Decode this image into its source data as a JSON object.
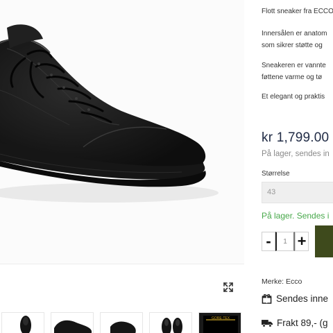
{
  "description": {
    "lines": [
      "Flott sneaker fra ECCO",
      "Innersålen er anatom",
      "som sikrer støtte og",
      "Sneakeren er vannte",
      "føttene varme og tø",
      "Et elegant og praktis"
    ]
  },
  "price": "kr 1,799.00",
  "stock_note": "På lager, sendes in",
  "size": {
    "label": "Størrelse",
    "selected": "43"
  },
  "stock_status": "På lager. Sendes i",
  "quantity": {
    "minus": "-",
    "value": "1",
    "plus": "+"
  },
  "brand": "Merke: Ecco",
  "shipping": {
    "dispatch": "Sendes inne",
    "freight": "Frakt 89,- (g"
  },
  "thumbnails": [
    {
      "alt": "shoe-front-thumbnail"
    },
    {
      "alt": "shoe-side-thumbnail"
    },
    {
      "alt": "shoe-back-thumbnail"
    },
    {
      "alt": "shoe-pair-thumbnail"
    },
    {
      "alt": "gore-tex-badge-thumbnail",
      "badge_text": "GORE-TEX"
    }
  ],
  "colors": {
    "price": "#1f2a44",
    "in_stock": "#47a84a",
    "cart_button": "#3e4a1c",
    "shoe": "#1a1a1a"
  }
}
